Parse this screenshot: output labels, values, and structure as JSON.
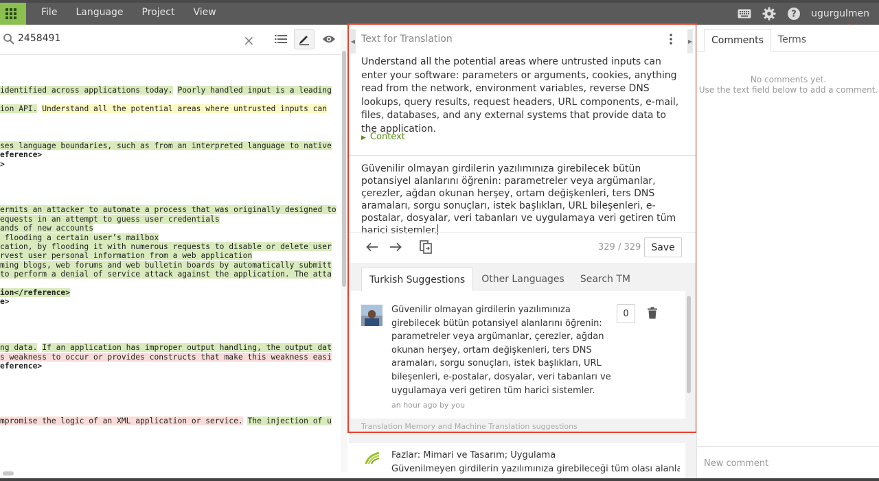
{
  "menu": [
    "File",
    "Language",
    "Project",
    "View"
  ],
  "user": "ugurgulmen",
  "search": {
    "value": "2458491"
  },
  "code_lines": [
    {
      "segs": []
    },
    {
      "segs": [
        {
          "t": "identified across applications today.",
          "c": "g"
        },
        {
          "t": " "
        },
        {
          "t": "Poorly handled input is a leading",
          "c": "g"
        }
      ]
    },
    {
      "segs": []
    },
    {
      "segs": [
        {
          "t": "ion API.",
          "c": "g"
        },
        {
          "t": " "
        },
        {
          "t": "Understand all the potential areas where untrusted inputs can",
          "c": "y"
        }
      ]
    },
    {
      "segs": []
    },
    {
      "segs": []
    },
    {
      "segs": []
    },
    {
      "segs": [
        {
          "t": "ses language boundaries, such as from an interpreted language to native",
          "c": "g"
        }
      ]
    },
    {
      "segs": [
        {
          "t": "eference>",
          "b": true
        }
      ]
    },
    {
      "segs": [
        {
          "t": ">",
          "b": true
        }
      ]
    },
    {
      "segs": []
    },
    {
      "segs": []
    },
    {
      "segs": []
    },
    {
      "segs": []
    },
    {
      "segs": [
        {
          "t": "ermits an attacker to automate a process that was originally designed to",
          "c": "g"
        }
      ]
    },
    {
      "segs": [
        {
          "t": "equests in an attempt to guess user credentials",
          "c": "g"
        }
      ]
    },
    {
      "segs": [
        {
          "t": "ands of new accounts",
          "c": "g"
        }
      ]
    },
    {
      "segs": [
        {
          "t": " flooding a certain user’s mailbox",
          "c": "g"
        }
      ]
    },
    {
      "segs": [
        {
          "t": "cation, by flooding it with numerous requests to disable or delete user",
          "c": "g"
        }
      ]
    },
    {
      "segs": [
        {
          "t": "rvest user personal information from a web application",
          "c": "g"
        }
      ]
    },
    {
      "segs": [
        {
          "t": "ming blogs, web forums and web bulletin boards by automatically submitt",
          "c": "g"
        }
      ]
    },
    {
      "segs": [
        {
          "t": "to perform a denial of service attack against the application. The atta",
          "c": "g"
        }
      ]
    },
    {
      "segs": []
    },
    {
      "segs": [
        {
          "t": "ion</reference>",
          "b": true,
          "c": "g"
        }
      ]
    },
    {
      "segs": [
        {
          "t": "e>",
          "b": true
        }
      ]
    },
    {
      "segs": []
    },
    {
      "segs": []
    },
    {
      "segs": []
    },
    {
      "segs": []
    },
    {
      "segs": [
        {
          "t": "ng data.",
          "c": "g"
        },
        {
          "t": " "
        },
        {
          "t": "If an application has improper output handling, the output dat",
          "c": "g"
        }
      ]
    },
    {
      "segs": [
        {
          "t": "s weakness to occur or provides constructs that make this weakness easi",
          "c": "p"
        }
      ]
    },
    {
      "segs": [
        {
          "t": "eference>",
          "b": true
        }
      ]
    },
    {
      "segs": []
    },
    {
      "segs": []
    },
    {
      "segs": []
    },
    {
      "segs": []
    },
    {
      "segs": []
    },
    {
      "segs": [
        {
          "t": "mpromise the logic of an XML application or service.",
          "c": "p"
        },
        {
          "t": " "
        },
        {
          "t": "The injection of u",
          "c": "g"
        }
      ]
    }
  ],
  "editor": {
    "title": "Text for Translation",
    "source": "Understand all the potential areas where untrusted inputs can enter your software: parameters or arguments, cookies, anything read from the network, environment variables, reverse DNS lookups, query results, request headers, URL components, e-mail, files, databases, and any external systems that provide data to the application.",
    "context_label": "Context",
    "target": "Güvenilir olmayan girdilerin yazılımınıza girebilecek bütün potansiyel alanlarını öğrenin: parametreler veya argümanlar, çerezler, ağdan okunan herşey, ortam değişkenleri, ters DNS aramaları, sorgu sonuçları, istek başlıkları, URL bileşenleri, e-postalar, dosyalar, veri tabanları ve uygulamaya veri getiren tüm harici sistemler.",
    "counter": "329 / 329",
    "save_label": "Save"
  },
  "suggestions": {
    "tabs": [
      "Turkish Suggestions",
      "Other Languages",
      "Search TM"
    ],
    "item": {
      "text": "Güvenilir olmayan girdilerin yazılımınıza girebilecek bütün potansiyel alanlarını öğrenin: parametreler veya argümanlar, çerezler, ağdan okunan herşey, ortam değişkenleri, ters DNS aramaları, sorgu sonuçları, istek başlıkları, URL bileşenleri, e-postalar, dosyalar, veri tabanları ve uygulamaya veri getiren tüm harici sistemler.",
      "meta": "an hour ago by you",
      "count": "0"
    },
    "tm_label": "Translation Memory and Machine Translation suggestions",
    "tm_item": {
      "title": "Fazlar: Mimari ve Tasarım; Uygulama",
      "text": "Güvenilmeyen girdilerin yazılımınıza girebileceği tüm olası alanları"
    }
  },
  "right_panel": {
    "tabs": [
      "Comments",
      "Terms"
    ],
    "empty_line1": "No comments yet.",
    "empty_line2": "Use the text field below to add a comment.",
    "new_comment_placeholder": "New comment"
  },
  "colors": {
    "accent_green": "#8bbf4f",
    "annotation_red": "#e8402c",
    "highlight_green": "#d9ebbd",
    "highlight_yellow": "#fbf8c4",
    "highlight_pink": "#f8dcd9"
  }
}
